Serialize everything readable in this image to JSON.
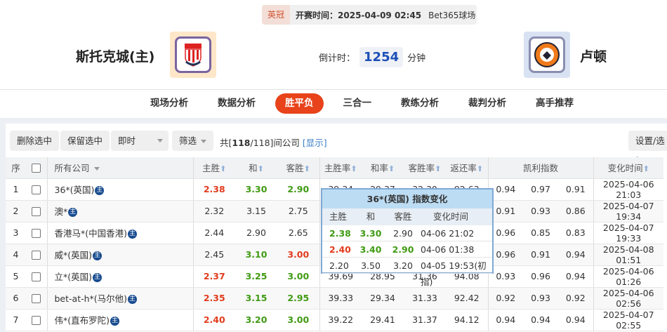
{
  "match": {
    "league": "英冠",
    "kickoff": "开赛时间：2025-04-09 02:45",
    "venue": "Bet365球场",
    "home": "斯托克城(主)",
    "away": "卢顿",
    "home_logo": "STOKE CITY",
    "away_logo": "LUTON TOWN FOOTBALL CLUB",
    "countdown_label": "倒计时：",
    "countdown": "1254",
    "countdown_unit": "分钟"
  },
  "nav": [
    "现场分析",
    "数据分析",
    "胜平负",
    "三合一",
    "教练分析",
    "裁判分析",
    "高手推荐"
  ],
  "nav_active": 2,
  "toolbar": {
    "delete": "删除选中",
    "keep": "保留选中",
    "mode": "即时",
    "filter": "筛选",
    "count_prefix": "共[",
    "count": "118",
    "count_suffix": "/118]间公司",
    "show": "[显示]",
    "settings": "设置/选择"
  },
  "table": {
    "headers": {
      "idx": "序",
      "company": "所有公司",
      "home": "主胜",
      "draw": "和",
      "away": "客胜",
      "home_rate": "主胜率",
      "draw_rate": "和率",
      "away_rate": "客胜率",
      "return_rate": "返还率",
      "kelly": "凯利指数",
      "time": "变化时间"
    },
    "rows": [
      {
        "idx": "1",
        "company": "36*(英国)",
        "odds": [
          "2.38",
          "3.30",
          "2.90"
        ],
        "colors": [
          "r",
          "g",
          "g"
        ],
        "rates": [
          "39.34",
          "29.37",
          "32.30",
          "92.63"
        ],
        "kelly": [
          "0.94",
          "0.97",
          "0.91"
        ],
        "time": "2025-04-06 21:03"
      },
      {
        "idx": "2",
        "company": "澳*",
        "odds": [
          "2.32",
          "3.15",
          "2.75"
        ],
        "colors": [
          "",
          "",
          ""
        ],
        "rates": [
          "",
          "",
          "",
          ""
        ],
        "kelly": [
          "0.91",
          "0.93",
          "0.86"
        ],
        "time": "2025-04-07 19:34"
      },
      {
        "idx": "3",
        "company": "香港马*(中国香港)",
        "odds": [
          "2.44",
          "2.90",
          "2.65"
        ],
        "colors": [
          "",
          "",
          ""
        ],
        "rates": [
          "",
          "",
          "",
          ""
        ],
        "kelly": [
          "0.96",
          "0.85",
          "0.83"
        ],
        "time": "2025-04-07 19:33"
      },
      {
        "idx": "4",
        "company": "威*(英国)",
        "odds": [
          "2.45",
          "3.10",
          "3.00"
        ],
        "colors": [
          "",
          "g",
          "r"
        ],
        "rates": [
          "",
          "",
          "",
          ""
        ],
        "kelly": [
          "0.96",
          "0.91",
          "0.94"
        ],
        "time": "2025-04-08 01:51"
      },
      {
        "idx": "5",
        "company": "立*(英国)",
        "odds": [
          "2.37",
          "3.25",
          "3.00"
        ],
        "colors": [
          "r",
          "g",
          "g"
        ],
        "rates": [
          "39.69",
          "28.95",
          "31.36",
          "94.08"
        ],
        "kelly": [
          "0.93",
          "0.96",
          "0.94"
        ],
        "time": "2025-04-06 01:26"
      },
      {
        "idx": "6",
        "company": "bet-at-h*(马尔他)",
        "odds": [
          "2.35",
          "3.15",
          "2.95"
        ],
        "colors": [
          "r",
          "g",
          "g"
        ],
        "rates": [
          "39.33",
          "29.34",
          "31.33",
          "92.42"
        ],
        "kelly": [
          "0.92",
          "0.93",
          "0.92"
        ],
        "time": "2025-04-06 02:56"
      },
      {
        "idx": "7",
        "company": "伟*(直布罗陀)",
        "odds": [
          "2.40",
          "3.20",
          "3.00"
        ],
        "colors": [
          "r",
          "g",
          "g"
        ],
        "rates": [
          "39.22",
          "29.41",
          "31.37",
          "94.12"
        ],
        "kelly": [
          "0.94",
          "0.94",
          "0.94"
        ],
        "time": "2025-04-07 02:55"
      }
    ]
  },
  "tooltip": {
    "title": "36*(英国) 指数变化",
    "headers": [
      "主胜",
      "和",
      "客胜",
      "变化时间"
    ],
    "rows": [
      {
        "v": [
          "2.38",
          "3.30",
          "2.90"
        ],
        "c": [
          "g",
          "g",
          ""
        ],
        "time": "04-06 21:02"
      },
      {
        "v": [
          "2.40",
          "3.40",
          "2.90"
        ],
        "c": [
          "r",
          "g",
          "g"
        ],
        "time": "04-06 01:38"
      },
      {
        "v": [
          "2.20",
          "3.50",
          "3.20"
        ],
        "c": [
          "",
          "",
          ""
        ],
        "time": "04-05 19:53(初指)"
      }
    ]
  },
  "colors": {
    "accent": "#e8431a",
    "up": "#e23b1c",
    "down": "#3f9a12",
    "countdown": "#1c4fb8",
    "badge": "#174b8f"
  }
}
